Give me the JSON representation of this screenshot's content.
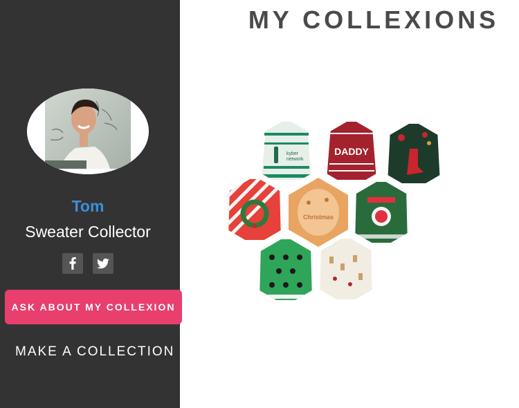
{
  "page": {
    "title": "MY COLLEXIONS"
  },
  "profile": {
    "name": "Tom",
    "title": "Sweater Collector",
    "avatar_alt": "profile photo"
  },
  "social": [
    {
      "name": "facebook",
      "glyph": "f"
    },
    {
      "name": "twitter",
      "glyph": "bird"
    }
  ],
  "actions": {
    "ask_label": "ASK ABOUT MY COLLEXION",
    "make_label": "MAKE A COLLECTION"
  },
  "colors": {
    "sidebar": "#333333",
    "accent_pink": "#e83f6f",
    "name_blue": "#3d8ee0",
    "title_gray": "#4a4a4a"
  },
  "collection": {
    "items": [
      {
        "id": "sweater-1",
        "label": "kyber network",
        "base": "#e8efe9",
        "stripe": "#1a8a63",
        "trim": "#1f6b4e"
      },
      {
        "id": "sweater-2",
        "label": "DADDY",
        "base": "#a3222e",
        "stripe": "#ffffff",
        "trim": "#ffffff"
      },
      {
        "id": "sweater-3",
        "label": "",
        "base": "#1d3b2b",
        "stripe": "#c8252f",
        "trim": "#d4a43a"
      },
      {
        "id": "sweater-4",
        "label": "",
        "base": "#e6413a",
        "stripe": "#f4f4f4",
        "trim": "#2f7a3b"
      },
      {
        "id": "sweater-5",
        "label": "",
        "base": "#e9a462",
        "stripe": "#f7d3a6",
        "trim": "#c0743a"
      },
      {
        "id": "sweater-6",
        "label": "",
        "base": "#2a6b3c",
        "stripe": "#e12f3f",
        "trim": "#f4f4f4"
      },
      {
        "id": "sweater-7",
        "label": "",
        "base": "#2fa55a",
        "stripe": "#1a1a1a",
        "trim": "#c8252f"
      },
      {
        "id": "sweater-8",
        "label": "",
        "base": "#f1ede3",
        "stripe": "#c9a16a",
        "trim": "#b02b2b"
      }
    ]
  }
}
